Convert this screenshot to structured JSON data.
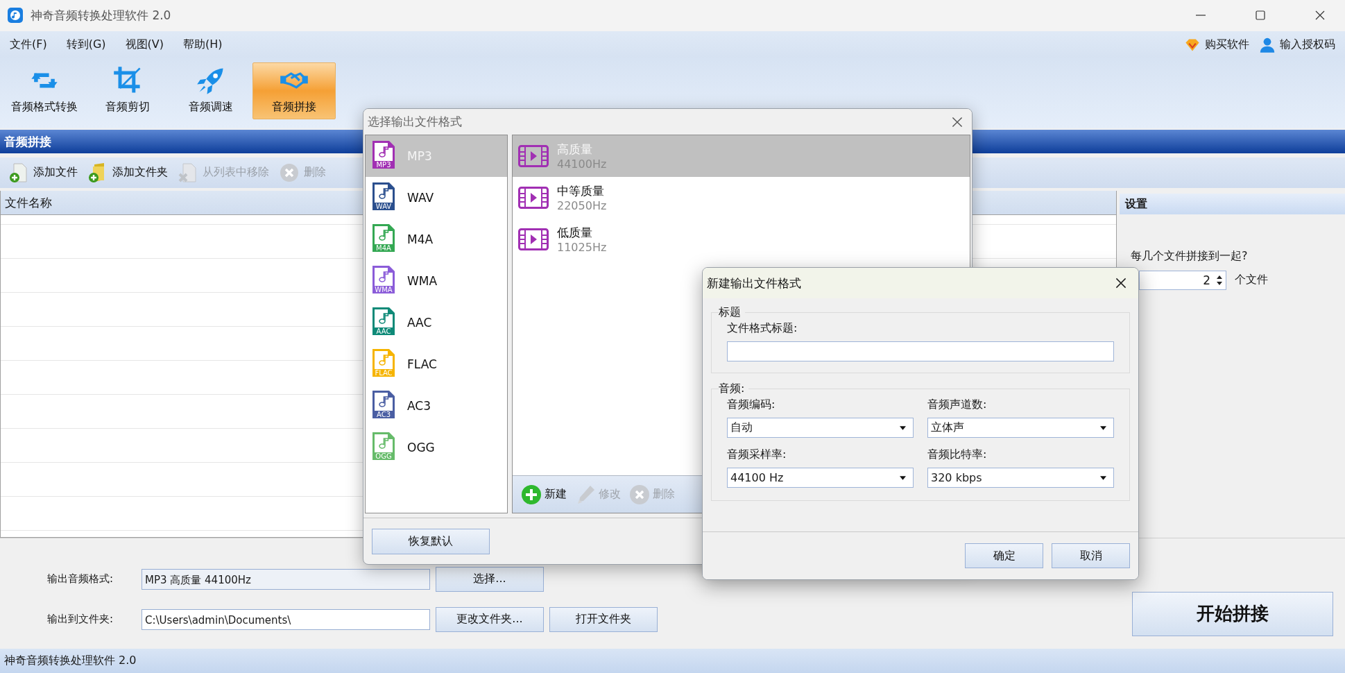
{
  "window": {
    "title": "神奇音频转换处理软件 2.0"
  },
  "menu": [
    {
      "label": "文件(F)"
    },
    {
      "label": "转到(G)"
    },
    {
      "label": "视图(V)"
    },
    {
      "label": "帮助(H)"
    }
  ],
  "account_links": [
    {
      "label": "购买软件",
      "kind": "buy"
    },
    {
      "label": "输入授权码",
      "kind": "user"
    }
  ],
  "modes": [
    {
      "label": "音频格式转换",
      "kind": "convert",
      "selected": false
    },
    {
      "label": "音频剪切",
      "kind": "crop",
      "selected": false
    },
    {
      "label": "音频调速",
      "kind": "speed",
      "selected": false
    },
    {
      "label": "音频拼接",
      "kind": "join",
      "selected": true
    }
  ],
  "panel": {
    "title": "音频拼接",
    "toolbar": [
      {
        "label": "添加文件",
        "kind": "add-file",
        "disabled": false
      },
      {
        "label": "添加文件夹",
        "kind": "add-folder",
        "disabled": false
      },
      {
        "label": "从列表中移除",
        "kind": "remove",
        "disabled": true
      },
      {
        "label": "删除",
        "kind": "delete",
        "disabled": true
      }
    ],
    "table": {
      "columns": [
        "文件名称"
      ]
    }
  },
  "settings": {
    "title": "设置",
    "question": "每几个文件拼接到一起?",
    "count": "2",
    "unit": "个文件"
  },
  "output": {
    "format_label": "输出音频格式:",
    "format_value": "MP3 高质量 44100Hz",
    "choose_button": "选择...",
    "folder_label": "输出到文件夹:",
    "folder_value": "C:\\Users\\admin\\Documents\\",
    "change_button": "更改文件夹...",
    "open_button": "打开文件夹"
  },
  "start_button": "开始拼接",
  "status_bar": "神奇音频转换处理软件 2.0",
  "format_dialog": {
    "title": "选择输出文件格式",
    "formats": [
      {
        "name": "MP3",
        "badge": "MP3",
        "color": "#a12fb3",
        "selected": true
      },
      {
        "name": "WAV",
        "badge": "WAV",
        "color": "#2b4f8e",
        "selected": false
      },
      {
        "name": "M4A",
        "badge": "M4A",
        "color": "#34a853",
        "selected": false
      },
      {
        "name": "WMA",
        "badge": "WMA",
        "color": "#8b5cd9",
        "selected": false
      },
      {
        "name": "AAC",
        "badge": "AAC",
        "color": "#0f8a78",
        "selected": false
      },
      {
        "name": "FLAC",
        "badge": "FLAC",
        "color": "#f6b400",
        "selected": false
      },
      {
        "name": "AC3",
        "badge": "AC3",
        "color": "#4a5ea3",
        "selected": false
      },
      {
        "name": "OGG",
        "badge": "OGG",
        "color": "#66bb6a",
        "selected": false
      }
    ],
    "presets": [
      {
        "name": "高质量",
        "rate": "44100Hz",
        "selected": true
      },
      {
        "name": "中等质量",
        "rate": "22050Hz",
        "selected": false
      },
      {
        "name": "低质量",
        "rate": "11025Hz",
        "selected": false
      }
    ],
    "actions": [
      {
        "label": "新建",
        "kind": "new",
        "disabled": false
      },
      {
        "label": "修改",
        "kind": "edit",
        "disabled": true
      },
      {
        "label": "删除",
        "kind": "delete",
        "disabled": true
      }
    ],
    "reset_button": "恢复默认"
  },
  "new_dialog": {
    "title": "新建输出文件格式",
    "title_group": "标题",
    "title_field_label": "文件格式标题:",
    "audio_group": "音频:",
    "fields": [
      {
        "label": "音频编码:",
        "value": "自动"
      },
      {
        "label": "音频声道数:",
        "value": "立体声"
      },
      {
        "label": "音频采样率:",
        "value": "44100 Hz"
      },
      {
        "label": "音频比特率:",
        "value": "320 kbps"
      }
    ],
    "ok_button": "确定",
    "cancel_button": "取消"
  }
}
